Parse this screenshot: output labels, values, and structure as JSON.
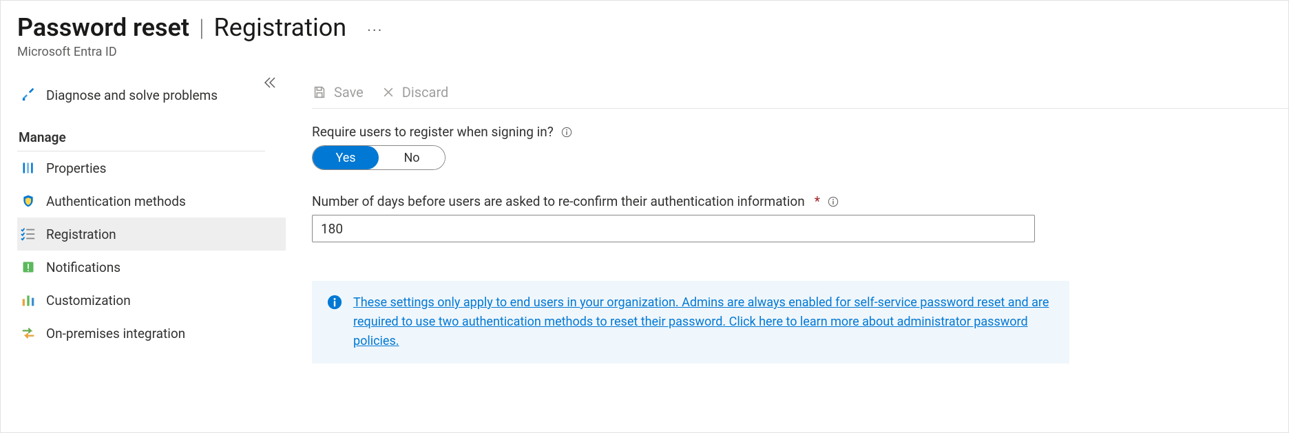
{
  "header": {
    "title": "Password reset",
    "subtitle": "Registration",
    "subheading": "Microsoft Entra ID"
  },
  "toolbar": {
    "save_label": "Save",
    "discard_label": "Discard"
  },
  "sidebar": {
    "diagnose_label": "Diagnose and solve problems",
    "manage_label": "Manage",
    "items": {
      "properties": "Properties",
      "auth_methods": "Authentication methods",
      "registration": "Registration",
      "notifications": "Notifications",
      "customization": "Customization",
      "onprem": "On-premises integration"
    }
  },
  "form": {
    "require_register_label": "Require users to register when signing in?",
    "toggle_yes": "Yes",
    "toggle_no": "No",
    "toggle_selected": "Yes",
    "days_label": "Number of days before users are asked to re-confirm their authentication information",
    "days_value": "180"
  },
  "banner": {
    "text": "These settings only apply to end users in your organization. Admins are always enabled for self-service password reset and are required to use two authentication methods to reset their password. Click here to learn more about administrator password policies."
  }
}
